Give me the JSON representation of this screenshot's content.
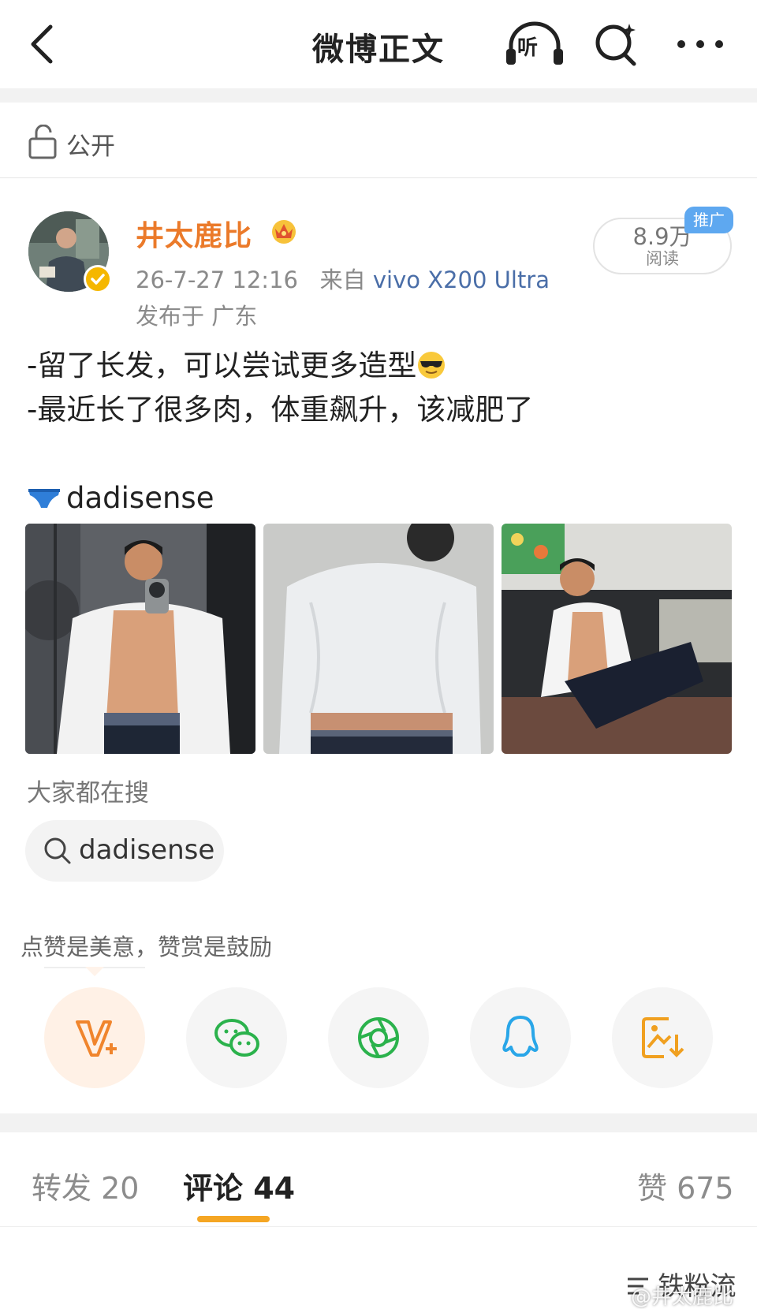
{
  "header": {
    "title": "微博正文",
    "listen_label": "听"
  },
  "visibility": {
    "label": "公开"
  },
  "author": {
    "name": "井太鹿比",
    "timestamp": "26-7-27 12:16",
    "source_prefix": "来自",
    "device": "vivo X200 Ultra",
    "location": "发布于 广东",
    "reads_count": "8.9万",
    "reads_label": "阅读",
    "promo_tag": "推广"
  },
  "post": {
    "line1": "-留了长发，可以尝试更多造型",
    "line2": "-最近长了很多肉，体重飙升，该减肥了",
    "brand_tag": "dadisense",
    "images": [
      {
        "name": "post-photo-1"
      },
      {
        "name": "post-photo-2"
      },
      {
        "name": "post-photo-3"
      }
    ]
  },
  "search_section": {
    "label": "大家都在搜",
    "chip": "dadisense"
  },
  "reward": {
    "tip": "点赞是美意，赞赏是鼓励"
  },
  "share_buttons": [
    {
      "icon": "reward-v-icon",
      "color": "#f0852d"
    },
    {
      "icon": "wechat-icon",
      "color": "#2bb24c"
    },
    {
      "icon": "moments-icon",
      "color": "#2bb24c"
    },
    {
      "icon": "qq-icon",
      "color": "#29a6e8"
    },
    {
      "icon": "save-image-icon",
      "color": "#f0a020"
    }
  ],
  "tabs": {
    "repost": "转发 20",
    "comments": "评论 44",
    "likes": "赞 675"
  },
  "footer": {
    "fans_flow": "铁粉流",
    "watermark": "@井太鹿比"
  },
  "colors": {
    "accent": "#f5a623",
    "author_name": "#eb7a2a",
    "link": "#4a6ea8"
  }
}
